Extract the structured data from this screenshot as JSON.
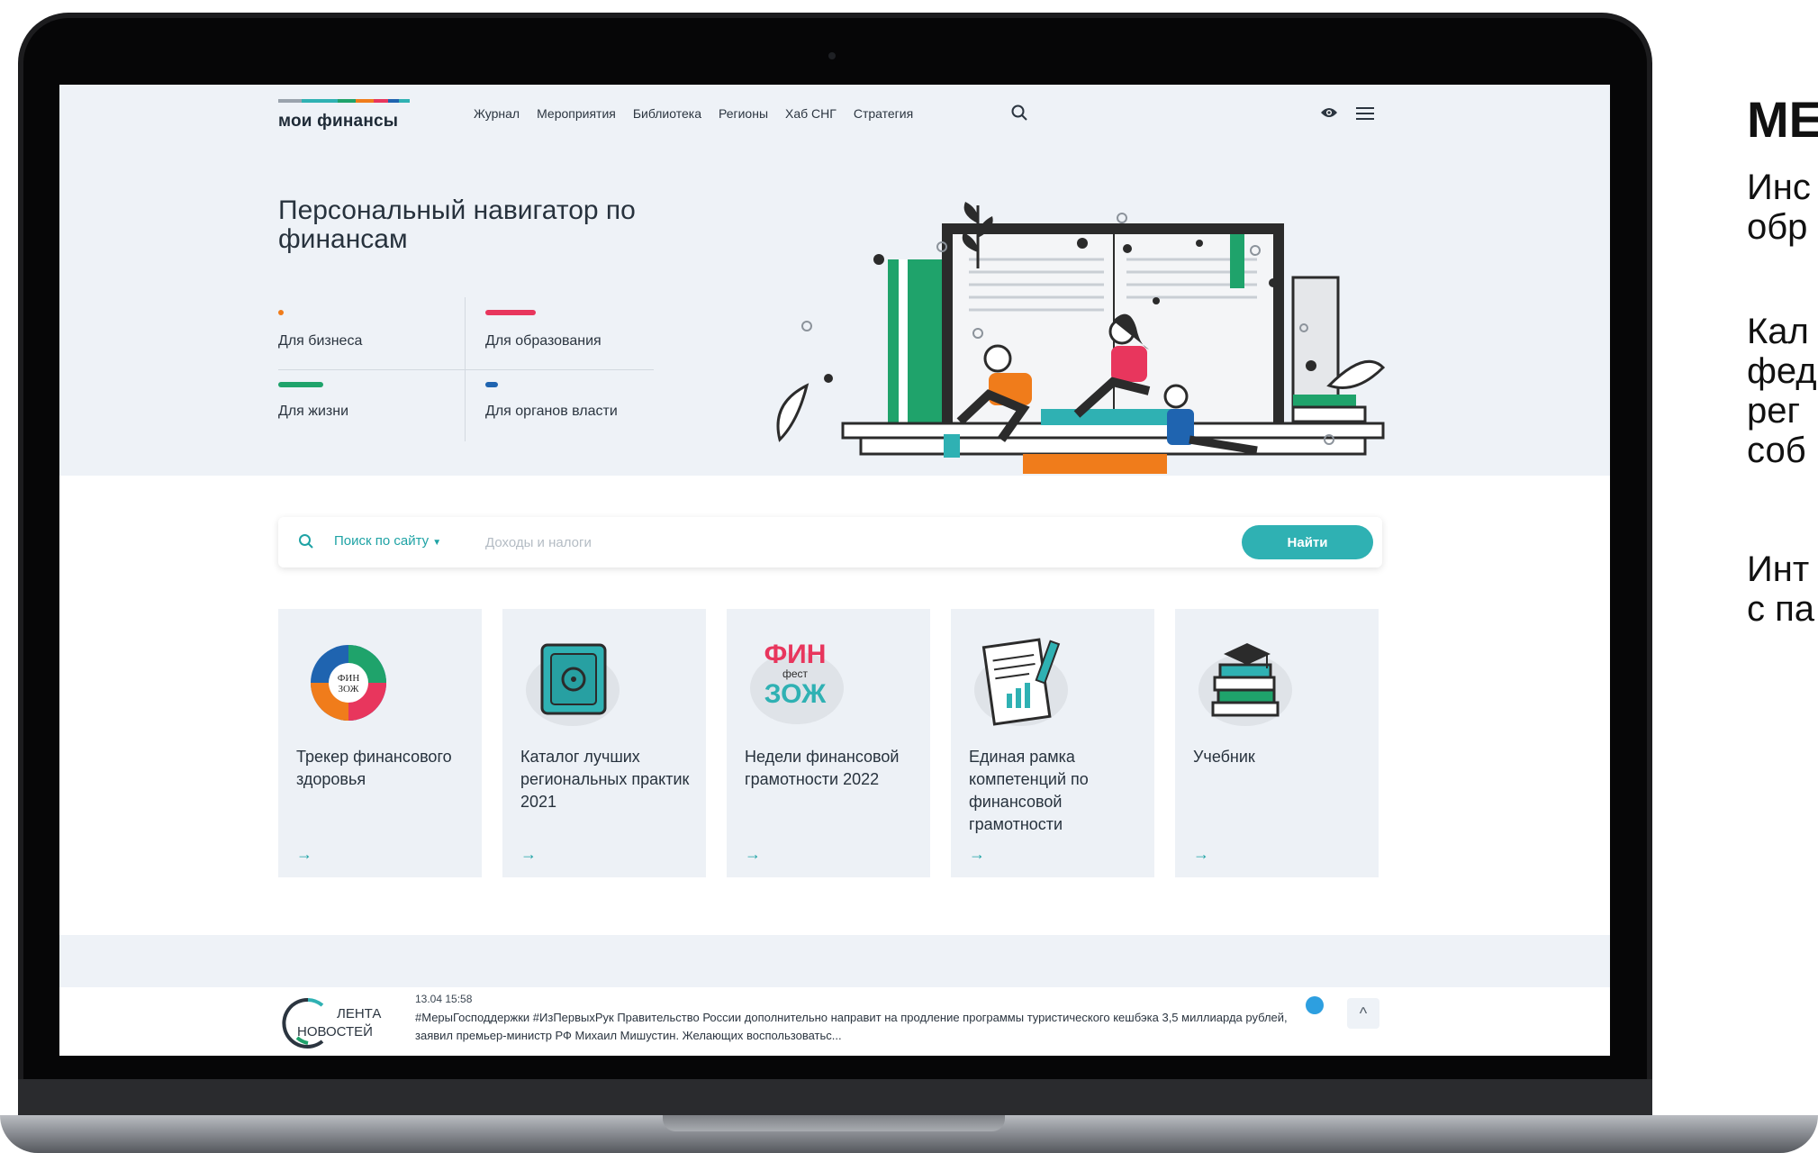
{
  "side": {
    "title": "МЕ",
    "lines": [
      "Инс",
      "обр",
      "Кал",
      "фед",
      "рег",
      "соб",
      "Инт",
      "с па"
    ]
  },
  "site": {
    "logo": "мои финансы",
    "logo_colors": [
      "#9aa3ad",
      "#2b3540",
      "#1fa36b",
      "#f07c1b",
      "#e8365d",
      "#1f64b0",
      "#2fb1b3"
    ],
    "nav": [
      "Журнал",
      "Мероприятия",
      "Библиотека",
      "Регионы",
      "Хаб СНГ",
      "Стратегия"
    ]
  },
  "hero": {
    "title": "Персональный навигатор по финансам",
    "categories": [
      {
        "label": "Для бизнеса",
        "color": "#f07c1b"
      },
      {
        "label": "Для образования",
        "color": "#e8365d"
      },
      {
        "label": "Для жизни",
        "color": "#1fa36b"
      },
      {
        "label": "Для органов власти",
        "color": "#1f64b0"
      }
    ]
  },
  "search": {
    "scope": "Поиск по сайту",
    "placeholder": "Доходы и налоги",
    "button": "Найти"
  },
  "cards": [
    {
      "title": "Трекер финансового здоровья",
      "arrow": "→",
      "icon": "finzozh-chart-icon"
    },
    {
      "title": "Каталог лучших региональных практик 2021",
      "arrow": "→",
      "icon": "safe-icon"
    },
    {
      "title": "Недели финансовой грамотности 2022",
      "arrow": "→",
      "icon": "finfest-icon",
      "icon_text": [
        "ФИН",
        "фест",
        "ЗОЖ"
      ]
    },
    {
      "title": "Единая рамка компетенций по финансовой грамотности",
      "arrow": "→",
      "icon": "document-icon"
    },
    {
      "title": "Учебник",
      "arrow": "→",
      "icon": "books-icon"
    }
  ],
  "news": {
    "logo_line1": "ЛЕНТА",
    "logo_line2": "НОВОСТЕЙ",
    "date": "13.04 15:58",
    "text": "#МерыГосподдержки #ИзПервыхРук Правительство России дополнительно направит на продление программы туристического кешбэка 3,5 миллиарда рублей, заявил премьер-министр РФ Михаил Мишустин. Желающих воспользоватьс...",
    "up": "^"
  }
}
